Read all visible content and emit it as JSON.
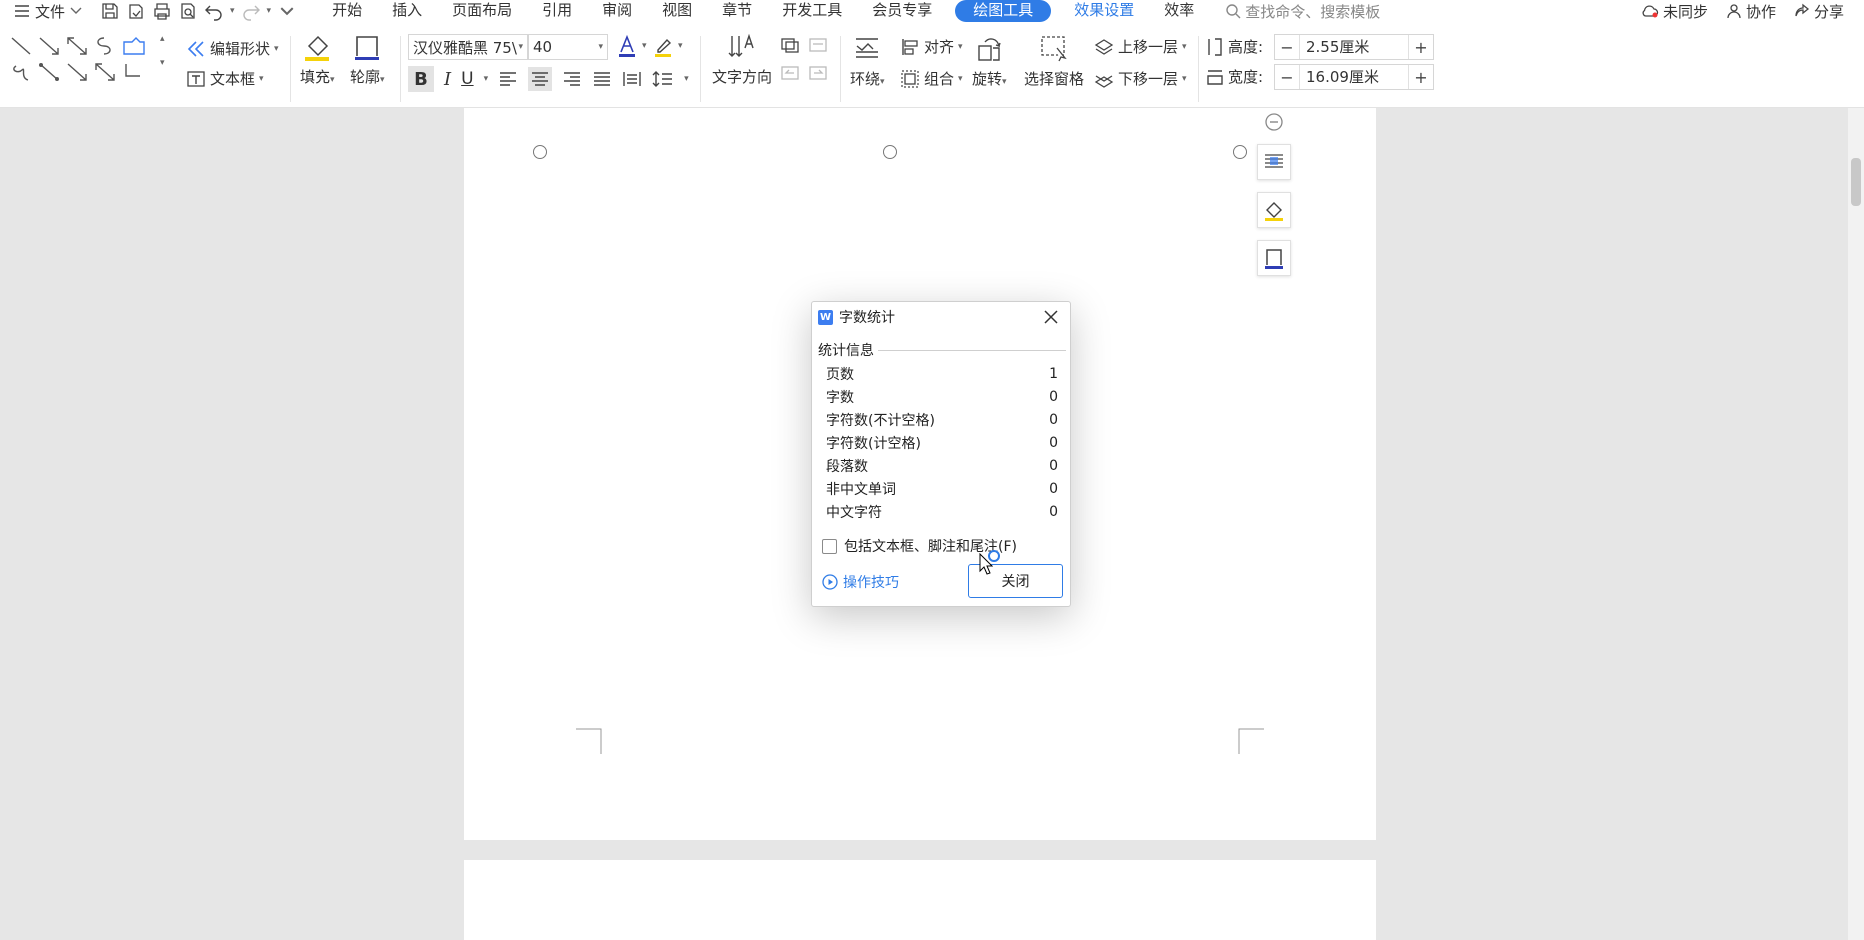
{
  "menubar": {
    "file_label": "文件",
    "tabs": [
      {
        "label": "开始"
      },
      {
        "label": "插入"
      },
      {
        "label": "页面布局"
      },
      {
        "label": "引用"
      },
      {
        "label": "审阅"
      },
      {
        "label": "视图"
      },
      {
        "label": "章节"
      },
      {
        "label": "开发工具"
      },
      {
        "label": "会员专享"
      },
      {
        "label": "绘图工具"
      },
      {
        "label": "效果设置"
      },
      {
        "label": "效率"
      }
    ],
    "active_tab": "绘图工具",
    "search_placeholder": "查找命令、搜索模板",
    "sync_label": "未同步",
    "collab_label": "协作",
    "share_label": "分享"
  },
  "ribbon": {
    "edit_shape_label": "编辑形状",
    "textbox_label": "文本框",
    "fill_label": "填充",
    "outline_label": "轮廓",
    "font_name": "汉仪雅酷黑 75\\",
    "font_size": "40",
    "text_direction_label": "文字方向",
    "wrap_label": "环绕",
    "align_label": "对齐",
    "group_label": "组合",
    "rotate_label": "旋转",
    "selection_pane_label": "选择窗格",
    "bring_forward_label": "上移一层",
    "send_backward_label": "下移一层",
    "height_label": "高度:",
    "height_value": "2.55厘米",
    "width_label": "宽度:",
    "width_value": "16.09厘米"
  },
  "dialog": {
    "title": "字数统计",
    "group_label": "统计信息",
    "stats": [
      {
        "label": "页数",
        "value": "1"
      },
      {
        "label": "字数",
        "value": "0"
      },
      {
        "label": "字符数(不计空格)",
        "value": "0"
      },
      {
        "label": "字符数(计空格)",
        "value": "0"
      },
      {
        "label": "段落数",
        "value": "0"
      },
      {
        "label": "非中文单词",
        "value": "0"
      },
      {
        "label": "中文字符",
        "value": "0"
      }
    ],
    "include_checkbox_label": "包括文本框、脚注和尾注(F)",
    "include_checked": false,
    "tips_label": "操作技巧",
    "close_label": "关闭"
  },
  "colors": {
    "accent": "#2f7ce6",
    "page_background": "#e6e6e6"
  }
}
